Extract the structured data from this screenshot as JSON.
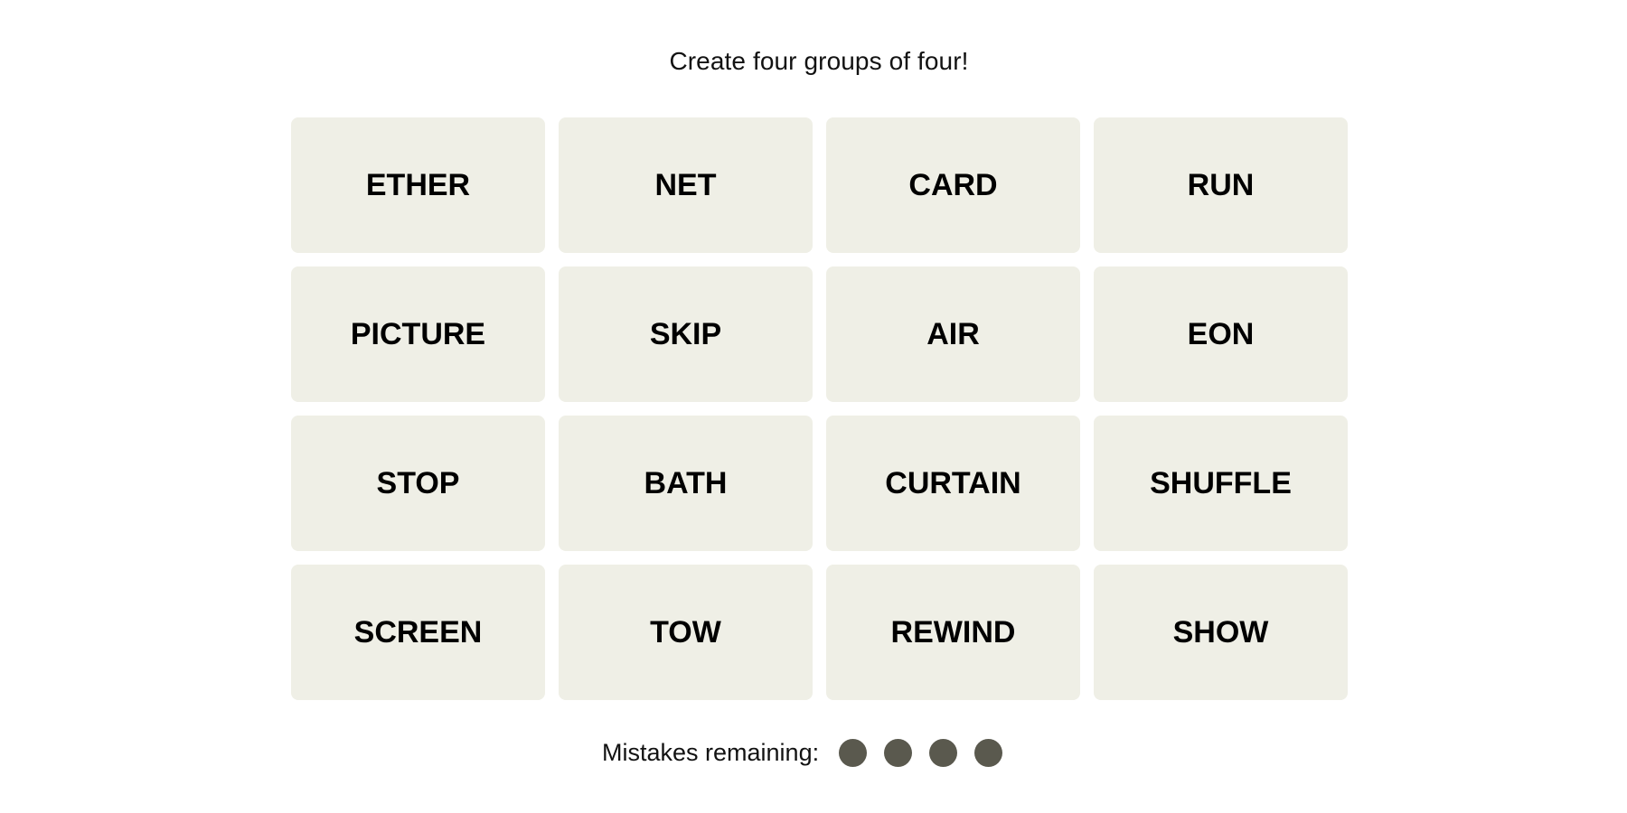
{
  "instructions": "Create four groups of four!",
  "tiles": [
    "ETHER",
    "NET",
    "CARD",
    "RUN",
    "PICTURE",
    "SKIP",
    "AIR",
    "EON",
    "STOP",
    "BATH",
    "CURTAIN",
    "SHUFFLE",
    "SCREEN",
    "TOW",
    "REWIND",
    "SHOW"
  ],
  "mistakes": {
    "label": "Mistakes remaining:",
    "remaining": 4,
    "total": 4
  },
  "colors": {
    "tile_background": "#efefe6",
    "tile_text": "#000000",
    "dot": "#5a594e",
    "text": "#121212"
  }
}
